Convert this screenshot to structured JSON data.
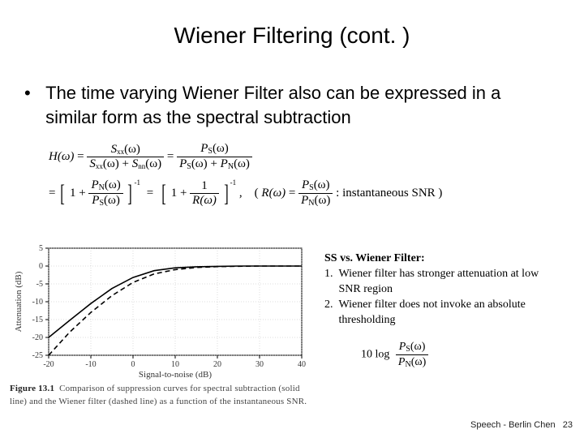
{
  "title": "Wiener Filtering (cont. )",
  "bullet": "The time varying Wiener Filter also can be expressed in a similar form as the spectral subtraction",
  "eq": {
    "H": "H(ω)",
    "eq": "=",
    "Sxx": "S",
    "xx_sub": "xx",
    "w": "(ω)",
    "Snn": "S",
    "nn_sub": "nn",
    "PS": "P",
    "S_sub": "S",
    "PN": "P",
    "N_sub": "N",
    "one": "1",
    "plus": "+",
    "Rw": "R(ω)",
    "comma": ",",
    "open": "(",
    "close": ")",
    "snr_label": ": instantaneous SNR",
    "neg1": "-1"
  },
  "side_note": {
    "heading": "SS vs. Wiener Filter:",
    "items": [
      "Wiener filter has stronger attenuation at low SNR region",
      "Wiener filter does not invoke an absolute thresholding"
    ]
  },
  "side_eq": {
    "tenlog": "10 log",
    "PS": "P",
    "S_sub": "S",
    "w": "(ω)",
    "PN": "P",
    "N_sub": "N"
  },
  "figure": {
    "caption_label": "Figure 13.1",
    "caption_text": "Comparison of suppression curves for spectral subtraction (solid line) and the Wiener filter (dashed line) as a function of the instantaneous SNR.",
    "xlabel": "Signal-to-noise (dB)",
    "ylabel": "Attenuation (dB)"
  },
  "footer": {
    "text": "Speech - Berlin Chen",
    "page": "23"
  },
  "chart_data": {
    "type": "line",
    "title": "",
    "xlabel": "Signal-to-noise (dB)",
    "ylabel": "Attenuation (dB)",
    "xlim": [
      -20,
      40
    ],
    "ylim": [
      -25,
      5
    ],
    "xticks": [
      -20,
      -10,
      0,
      10,
      20,
      30,
      40
    ],
    "yticks": [
      -25,
      -20,
      -15,
      -10,
      -5,
      0,
      5
    ],
    "series": [
      {
        "name": "Spectral subtraction (solid)",
        "style": "solid",
        "x": [
          -20,
          -15,
          -10,
          -5,
          0,
          5,
          10,
          15,
          20,
          25,
          30,
          35,
          40
        ],
        "y": [
          -20.0,
          -15.2,
          -10.5,
          -6.3,
          -3.2,
          -1.3,
          -0.5,
          -0.2,
          -0.1,
          0.0,
          0.0,
          0.0,
          0.0
        ]
      },
      {
        "name": "Wiener filter (dashed)",
        "style": "dashed",
        "x": [
          -20,
          -15,
          -10,
          -5,
          0,
          5,
          10,
          15,
          20,
          25,
          30,
          35,
          40
        ],
        "y": [
          -25.0,
          -18.5,
          -13.0,
          -8.3,
          -4.6,
          -2.2,
          -1.0,
          -0.4,
          -0.15,
          -0.07,
          0.0,
          0.0,
          0.0
        ]
      }
    ]
  }
}
